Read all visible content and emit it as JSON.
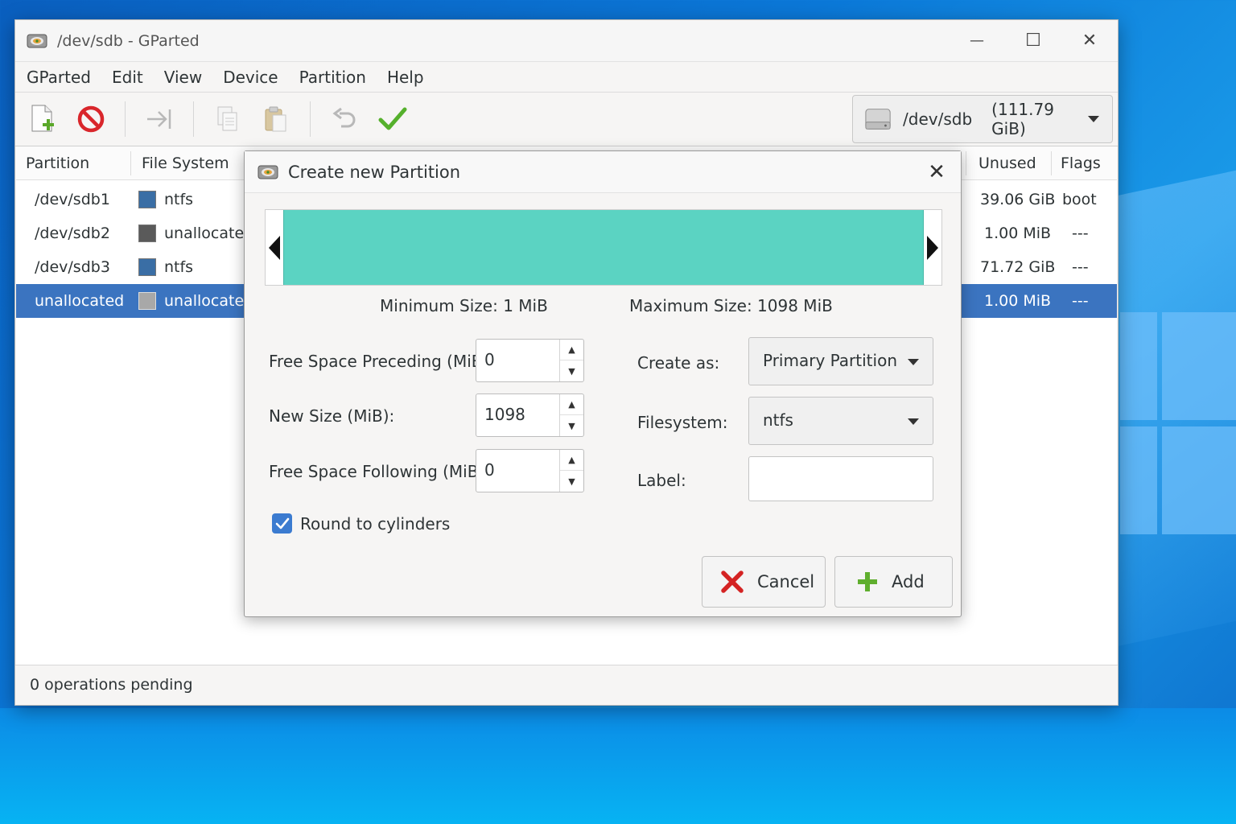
{
  "window": {
    "title": "/dev/sdb - GParted",
    "controls": {
      "minimize": "—",
      "maximize": "☐",
      "close": "✕"
    }
  },
  "menubar": [
    "GParted",
    "Edit",
    "View",
    "Device",
    "Partition",
    "Help"
  ],
  "toolbar": {
    "icons": [
      "new-partition-icon",
      "delete-icon",
      "resize-move-icon",
      "copy-icon",
      "paste-icon",
      "undo-icon",
      "apply-icon"
    ],
    "device": {
      "name": "/dev/sdb",
      "size": "(111.79 GiB)"
    }
  },
  "partition_list": {
    "columns": [
      "Partition",
      "File System",
      "Unused",
      "Flags"
    ],
    "rows": [
      {
        "partition": "/dev/sdb1",
        "filesystem": "ntfs",
        "fs_color": "#3a6ea5",
        "unused": "39.06 GiB",
        "flags": "boot",
        "selected": false
      },
      {
        "partition": "/dev/sdb2",
        "filesystem": "unallocated",
        "fs_color": "#5a5a5a",
        "unused": "1.00 MiB",
        "flags": "---",
        "selected": false
      },
      {
        "partition": "/dev/sdb3",
        "filesystem": "ntfs",
        "fs_color": "#3a6ea5",
        "unused": "71.72 GiB",
        "flags": "---",
        "selected": false
      },
      {
        "partition": "unallocated",
        "filesystem": "unallocated",
        "fs_color": "#a8a8a8",
        "unused": "1.00 MiB",
        "flags": "---",
        "selected": true
      }
    ]
  },
  "status": "0 operations pending",
  "dialog": {
    "title": "Create new Partition",
    "close": "✕",
    "min_size": "Minimum Size: 1 MiB",
    "max_size": "Maximum Size: 1098 MiB",
    "free_preceding": {
      "label": "Free Space Preceding (MiB):",
      "value": "0"
    },
    "new_size": {
      "label": "New Size (MiB):",
      "value": "1098"
    },
    "free_following": {
      "label": "Free Space Following (MiB):",
      "value": "0"
    },
    "create_as": {
      "label": "Create as:",
      "value": "Primary Partition"
    },
    "filesystem": {
      "label": "Filesystem:",
      "value": "ntfs"
    },
    "label_field": {
      "label": "Label:",
      "value": ""
    },
    "round_to_cylinders": {
      "label": "Round to cylinders",
      "checked": true
    },
    "cancel": "Cancel",
    "add": "Add",
    "bar_color": "#5bd3c2"
  }
}
